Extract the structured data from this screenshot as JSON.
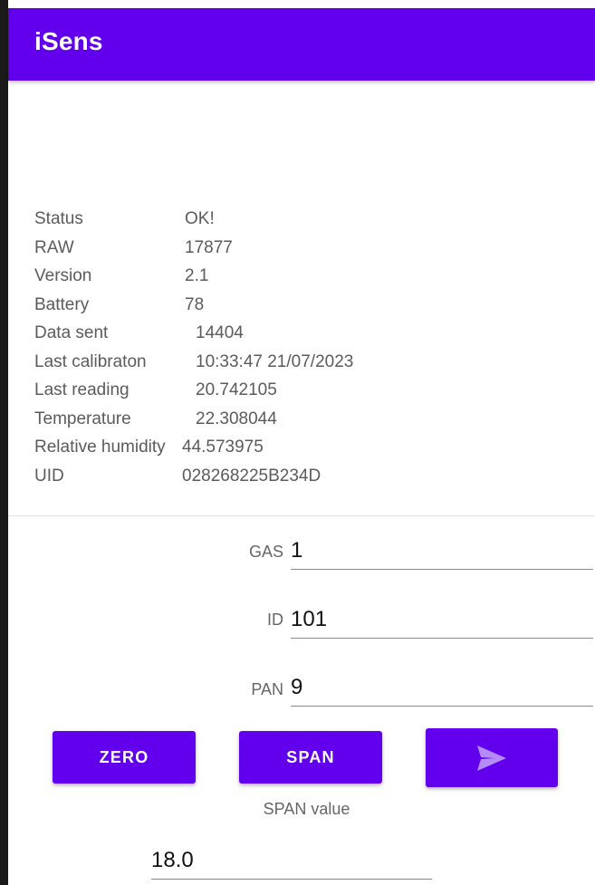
{
  "app": {
    "title": "iSens"
  },
  "info": [
    {
      "label": "Status",
      "value": "OK!"
    },
    {
      "label": "RAW",
      "value": "17877"
    },
    {
      "label": "Version",
      "value": "2.1"
    },
    {
      "label": "Battery",
      "value": "78"
    },
    {
      "label": "Data sent",
      "value": "14404"
    },
    {
      "label": "Last calibraton",
      "value": "10:33:47 21/07/2023"
    },
    {
      "label": "Last reading",
      "value": "20.742105"
    },
    {
      "label": "Temperature",
      "value": "22.308044"
    },
    {
      "label": "Relative humidity",
      "value": "44.573975"
    },
    {
      "label": "UID",
      "value": "028268225B234D"
    }
  ],
  "fields": {
    "gas": {
      "label": "GAS",
      "value": "1"
    },
    "id": {
      "label": "ID",
      "value": "101"
    },
    "pan": {
      "label": "PAN",
      "value": "9"
    }
  },
  "buttons": {
    "zero": "ZERO",
    "span": "SPAN",
    "send_icon": "send-icon"
  },
  "span_value": {
    "caption": "SPAN value",
    "value": "18.0"
  },
  "colors": {
    "primary": "#6200ee",
    "send_icon": "#b48cf5"
  }
}
